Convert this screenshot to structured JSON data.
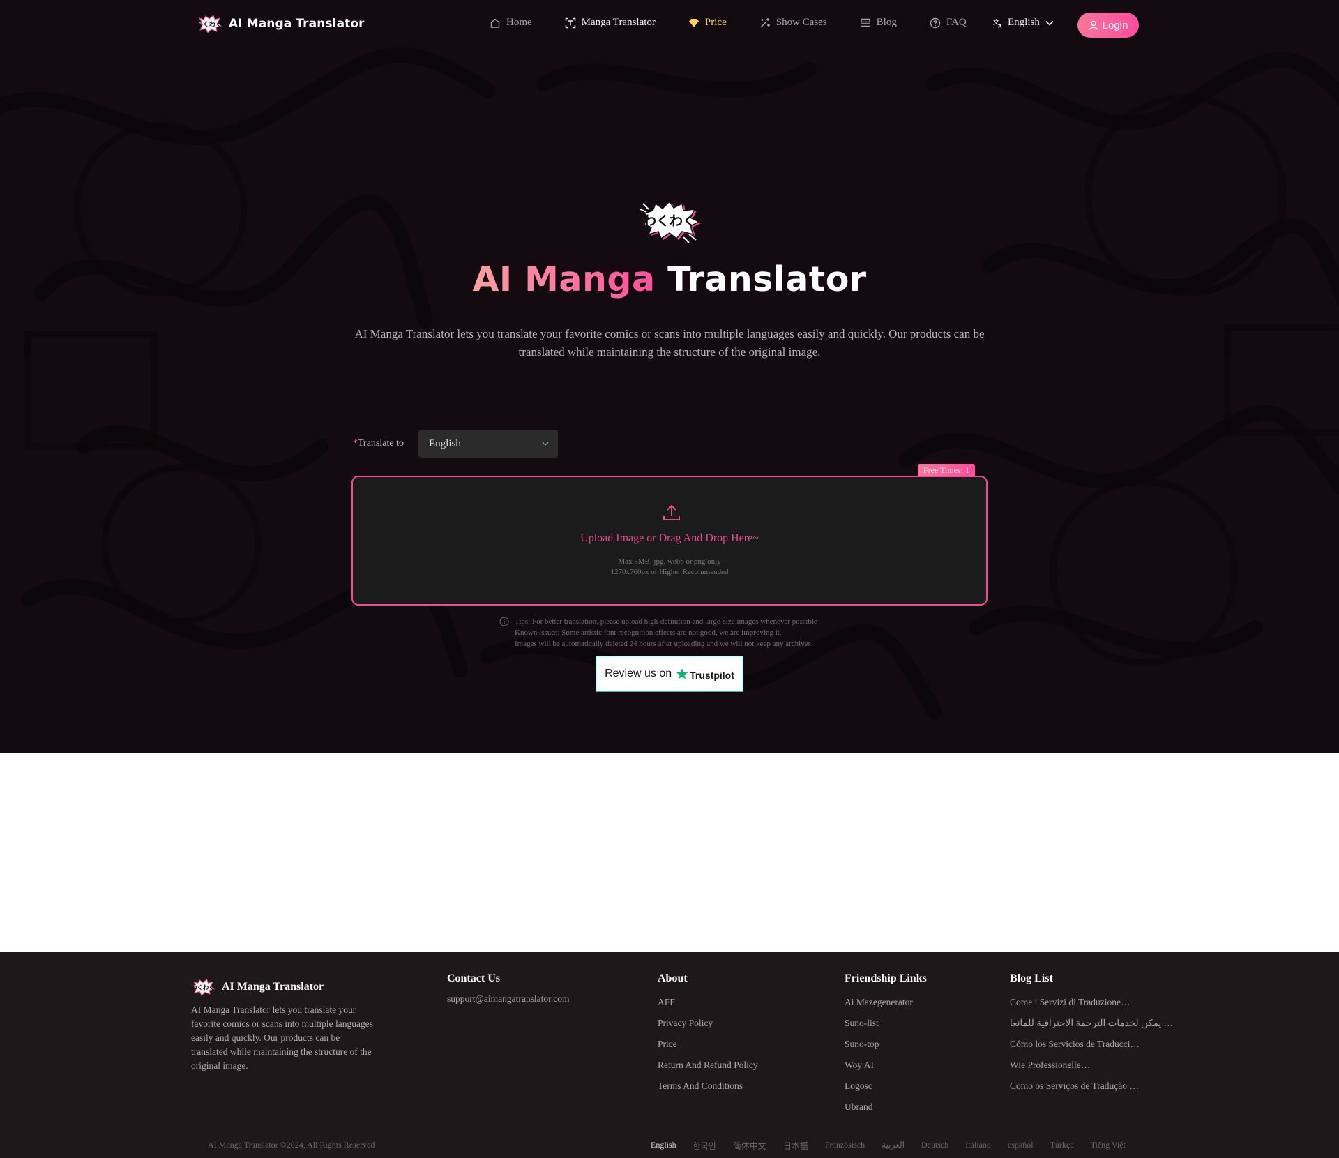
{
  "nav": {
    "brand": "AI Manga Translator",
    "items": [
      {
        "label": "Home",
        "icon": "home-icon"
      },
      {
        "label": "Manga Translator",
        "icon": "text-scan-icon"
      },
      {
        "label": "Price",
        "icon": "diamond-icon"
      },
      {
        "label": "Show Cases",
        "icon": "magic-wand-icon"
      },
      {
        "label": "Blog",
        "icon": "blog-icon"
      },
      {
        "label": "FAQ",
        "icon": "help-circle-icon"
      }
    ],
    "language": "English",
    "login_label": "Login"
  },
  "hero": {
    "title_accent": "AI Manga",
    "title_rest": "Translator",
    "description": "AI Manga Translator lets you translate your favorite comics or scans into multiple languages easily and quickly. Our products can be translated while maintaining the structure of the original image."
  },
  "form": {
    "required_mark": "*",
    "translate_label": "Translate to",
    "target_language": "English",
    "free_times": "Free Times: 1",
    "upload_title": "Upload Image or Drag And Drop Here~",
    "upload_hint_1": "Max 5MB, jpg, webp or.png only",
    "upload_hint_2": "1270x760px or Higher Recommended",
    "tips": [
      "Tips: For better translation, please upload high-definition and large-size images whenever possible",
      "Known issues: Some artistic font recognition effects are not good, we are improving it.",
      "Images will be automatically deleted 24 hours after uploading and we will not keep any archives."
    ],
    "trustpilot_text": "Review us on",
    "trustpilot_brand": "Trustpilot"
  },
  "colors": {
    "accent_pink": "#ef4d92",
    "price_gold": "#f6d35a",
    "trustpilot_green": "#04da8d"
  },
  "footer": {
    "brand": "AI Manga Translator",
    "description": "AI Manga Translator lets you translate your favorite comics or scans into multiple languages easily and quickly. Our products can be translated while maintaining the structure of the original image.",
    "contact": {
      "title": "Contact Us",
      "email": "support@aimangatranslator.com"
    },
    "about": {
      "title": "About",
      "links": [
        "AFF",
        "Privacy Policy",
        "Price",
        "Return And Refund Policy",
        "Terms And Conditions"
      ]
    },
    "friendship": {
      "title": "Friendship Links",
      "links": [
        "Ai Mazegenerator",
        "Suno-list",
        "Suno-top",
        "Woy AI",
        "Logosc",
        "Ubrand"
      ]
    },
    "blog": {
      "title": "Blog List",
      "links": [
        "Come i Servizi di Traduzione…",
        "… يمكن لخدمات الترجمة الاحترافية للمانغا",
        "Cómo los Servicios de Traducci…",
        "Wie Professionelle…",
        "Como os Serviços de Tradução …"
      ]
    },
    "copyright": "AI Manga Translator ©2024, All Rights Reserved",
    "languages": [
      "English",
      "한국인",
      "简体中文",
      "日本語",
      "Französisch",
      "العربية",
      "Deutsch",
      "Italiano",
      "español",
      "Türkçe",
      "Tiếng Việt"
    ],
    "current_language": "English"
  }
}
